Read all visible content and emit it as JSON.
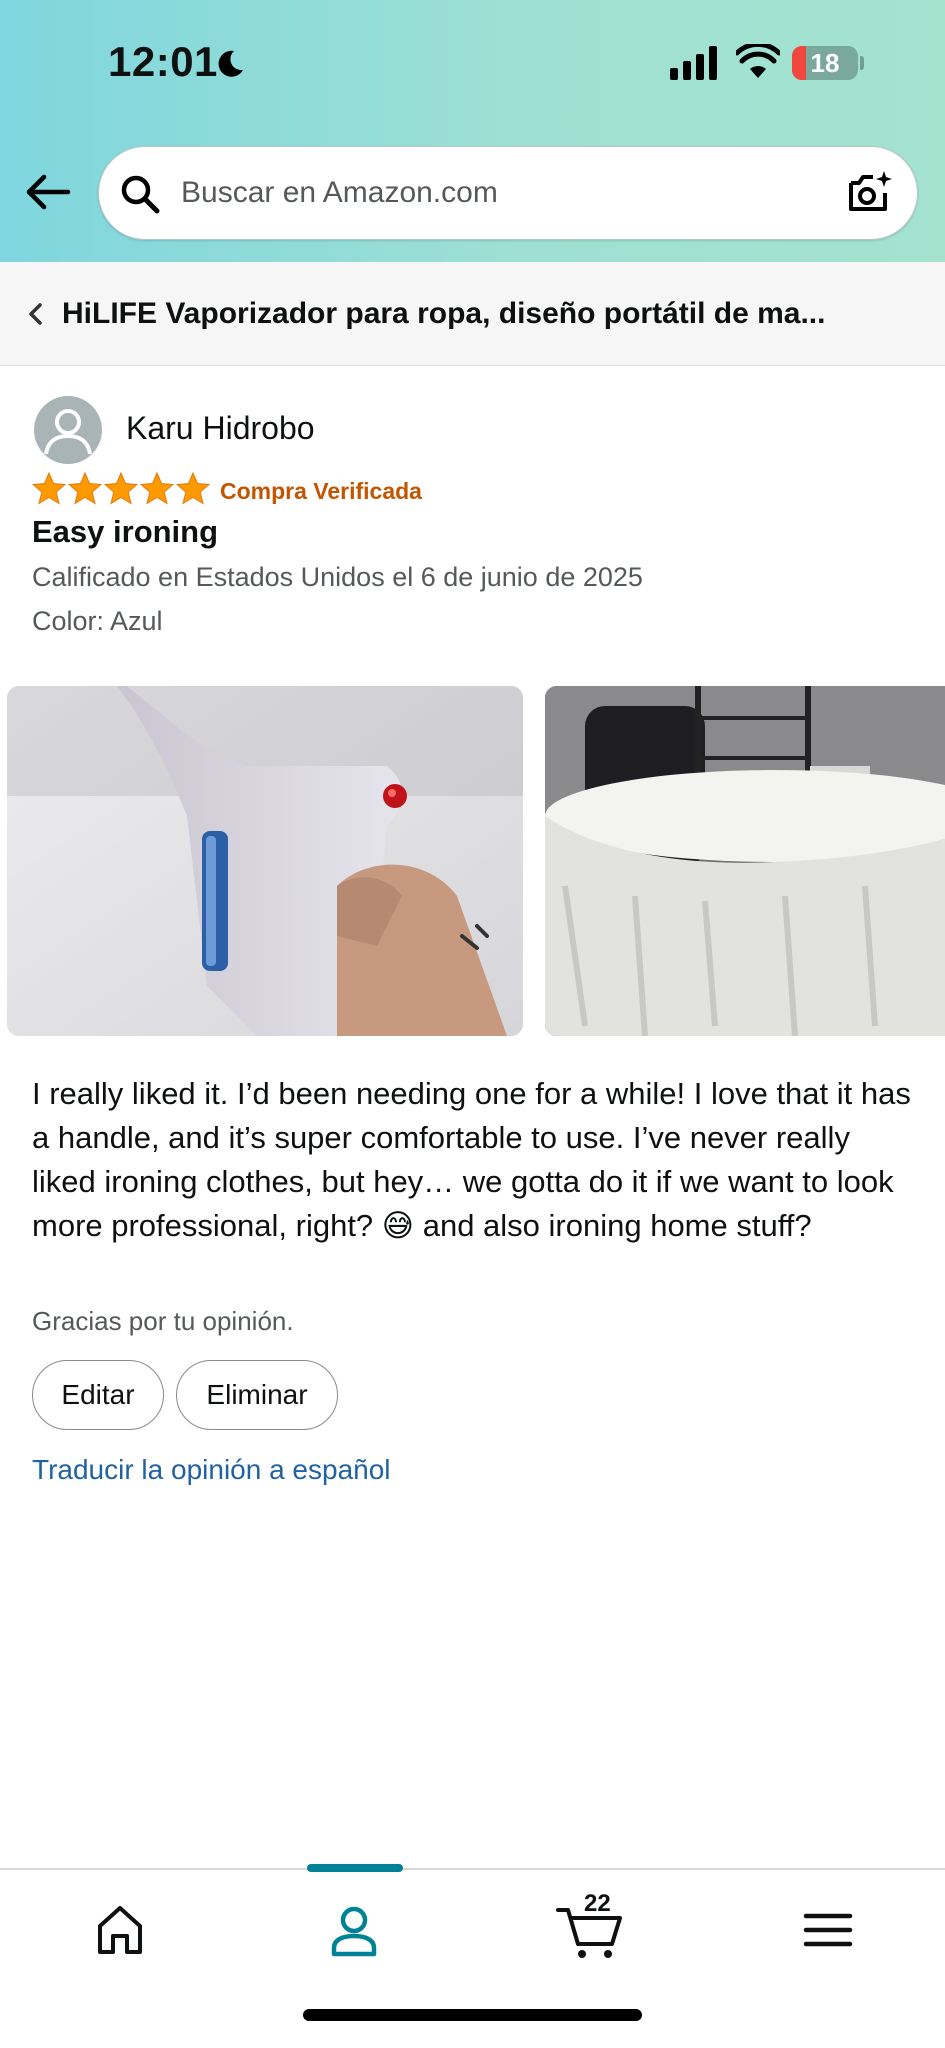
{
  "status_bar": {
    "time": "12:01",
    "battery": "18"
  },
  "search": {
    "placeholder": "Buscar en Amazon.com"
  },
  "product": {
    "title": "HiLIFE Vaporizador para ropa, diseño portátil de ma..."
  },
  "review": {
    "reviewer": "Karu Hidrobo",
    "rating": 5,
    "verified_label": "Compra Verificada",
    "title": "Easy ironing",
    "date": "Calificado en Estados Unidos el 6 de junio de 2025",
    "color": "Color: Azul",
    "body": "I really liked it. I’d been needing one for a while! I love that it has a handle, and it’s super comfortable to use. I’ve never really liked ironing clothes, but hey… we gotta do it if we want to look more professional, right? 😅 and also ironing home stuff?",
    "thanks": "Gracias por tu opinión.",
    "edit_label": "Editar",
    "delete_label": "Eliminar",
    "translate_label": "Traducir la opinión a español"
  },
  "bottom_nav": {
    "cart_count": "22"
  },
  "colors": {
    "star": "#ff9900",
    "verified": "#c45500",
    "link": "#2162a1",
    "accent": "#008296"
  }
}
